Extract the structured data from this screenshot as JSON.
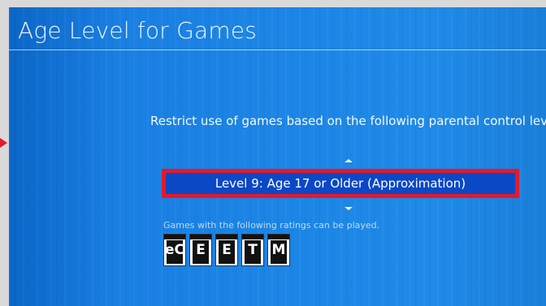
{
  "screen": {
    "title": "Age Level for Games",
    "instruction": "Restrict use of games based on the following parental control level.",
    "selected_level": "Level 9: Age 17 or Older (Approximation)",
    "ratings_caption": "Games with the following ratings can be played.",
    "ratings": [
      {
        "icon": "esrb-early-childhood-icon",
        "letter": "eC"
      },
      {
        "icon": "esrb-everyone-icon",
        "letter": "E"
      },
      {
        "icon": "esrb-everyone-10-icon",
        "letter": "E"
      },
      {
        "icon": "esrb-teen-icon",
        "letter": "T"
      },
      {
        "icon": "esrb-mature-icon",
        "letter": "M"
      }
    ]
  },
  "colors": {
    "background": "#1a7fe2",
    "highlight_border": "#e3192b",
    "selection_fill": "#0b48c6"
  }
}
